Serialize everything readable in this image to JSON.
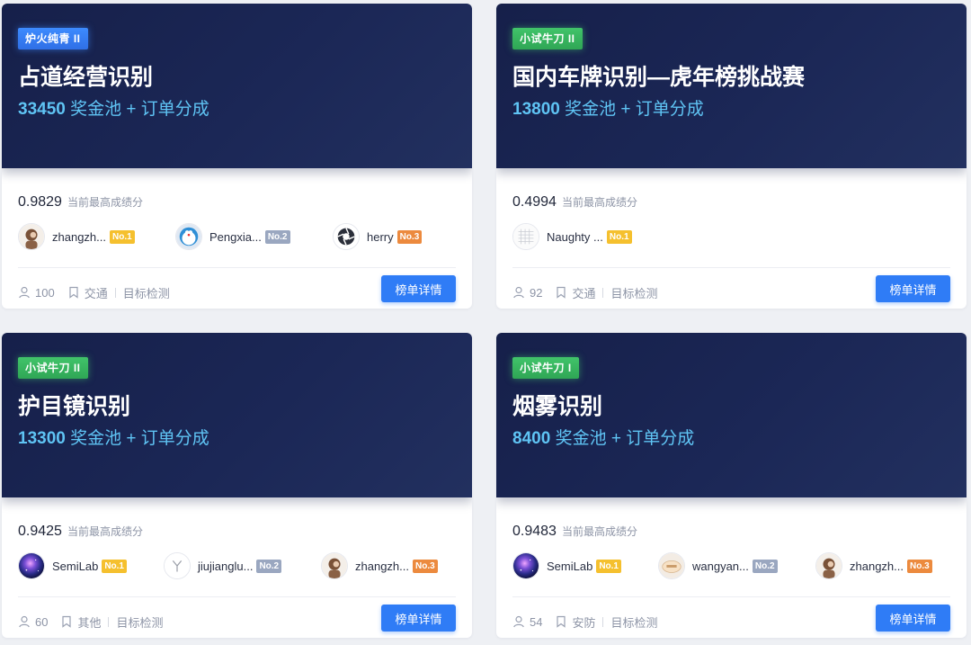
{
  "score_label": "当前最高成绩分",
  "prize_suffix": "奖金池 + 订单分成",
  "button_label": "榜单详情",
  "cards": [
    {
      "badge": "炉火纯青 II",
      "badge_color": "#3d8bff",
      "title": "占道经营识别",
      "prize_amount": "33450",
      "score": "0.9829",
      "leaders": [
        {
          "name": "zhangzh...",
          "rank": "No.1",
          "avatar": "person-avatar"
        },
        {
          "name": "Pengxia...",
          "rank": "No.2",
          "avatar": "doraemon-avatar"
        },
        {
          "name": "herry",
          "rank": "No.3",
          "avatar": "aperture-avatar"
        }
      ],
      "participants": "100",
      "industry": "交通",
      "task": "目标检测"
    },
    {
      "badge": "小试牛刀 II",
      "badge_color": "#41c46a",
      "title": "国内车牌识别—虎年榜挑战赛",
      "prize_amount": "13800",
      "score": "0.4994",
      "leaders": [
        {
          "name": "Naughty ...",
          "rank": "No.1",
          "avatar": "sketch-avatar"
        }
      ],
      "participants": "92",
      "industry": "交通",
      "task": "目标检测"
    },
    {
      "badge": "小试牛刀 II",
      "badge_color": "#41c46a",
      "title": "护目镜识别",
      "prize_amount": "13300",
      "score": "0.9425",
      "leaders": [
        {
          "name": "SemiLab",
          "rank": "No.1",
          "avatar": "galaxy-avatar"
        },
        {
          "name": "jiujianglu...",
          "rank": "No.2",
          "avatar": "logo-avatar"
        },
        {
          "name": "zhangzh...",
          "rank": "No.3",
          "avatar": "person-avatar"
        }
      ],
      "participants": "60",
      "industry": "其他",
      "task": "目标检测"
    },
    {
      "badge": "小试牛刀 I",
      "badge_color": "#41c46a",
      "title": "烟雾识别",
      "prize_amount": "8400",
      "score": "0.9483",
      "leaders": [
        {
          "name": "SemiLab",
          "rank": "No.1",
          "avatar": "galaxy-avatar"
        },
        {
          "name": "wangyan...",
          "rank": "No.2",
          "avatar": "cartoon-avatar"
        },
        {
          "name": "zhangzh...",
          "rank": "No.3",
          "avatar": "person-avatar"
        }
      ],
      "participants": "54",
      "industry": "安防",
      "task": "目标检测"
    }
  ]
}
